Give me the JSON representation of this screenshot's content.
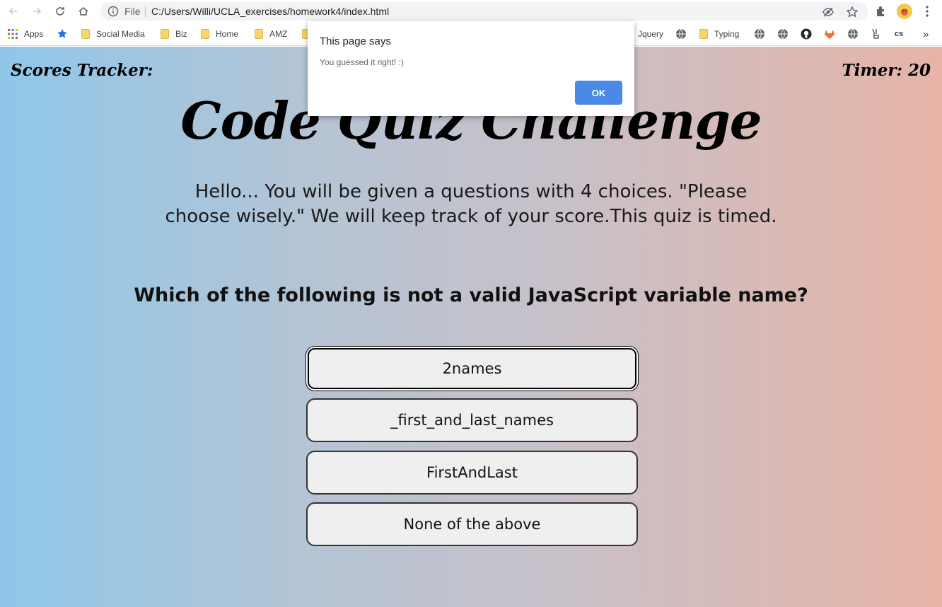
{
  "browser": {
    "omnibox": {
      "scheme_label": "File",
      "url": "C:/Users/Willi/UCLA_exercises/homework4/index.html"
    },
    "bookmarks": [
      {
        "label": "Apps"
      },
      {
        "label": "Social Media"
      },
      {
        "label": "Biz"
      },
      {
        "label": "Home"
      },
      {
        "label": "AMZ"
      },
      {
        "label": "Jquery"
      },
      {
        "label": "Typing"
      },
      {
        "label": "CS"
      }
    ],
    "more_label": "»"
  },
  "quiz": {
    "scores_label": "Scores Tracker:",
    "timer_label": "Timer:",
    "timer_value": "20",
    "title": "Code Quiz Challenge",
    "intro": "Hello... You will be given a questions with 4 choices. \"Please choose wisely.\" We will keep track of your score.This quiz is timed.",
    "question": "Which of the following is not a valid JavaScript variable name?",
    "choices": [
      {
        "label": "2names"
      },
      {
        "label": "_first_and_last_names"
      },
      {
        "label": "FirstAndLast"
      },
      {
        "label": "None of the above"
      }
    ]
  },
  "dialog": {
    "title": "This page says",
    "message": "You guessed it right! :)",
    "ok_label": "OK"
  },
  "colors": {
    "ok_button": "#4a8ae6",
    "gradient_left": "#8fc7e9",
    "gradient_right": "#e6b4a6"
  }
}
